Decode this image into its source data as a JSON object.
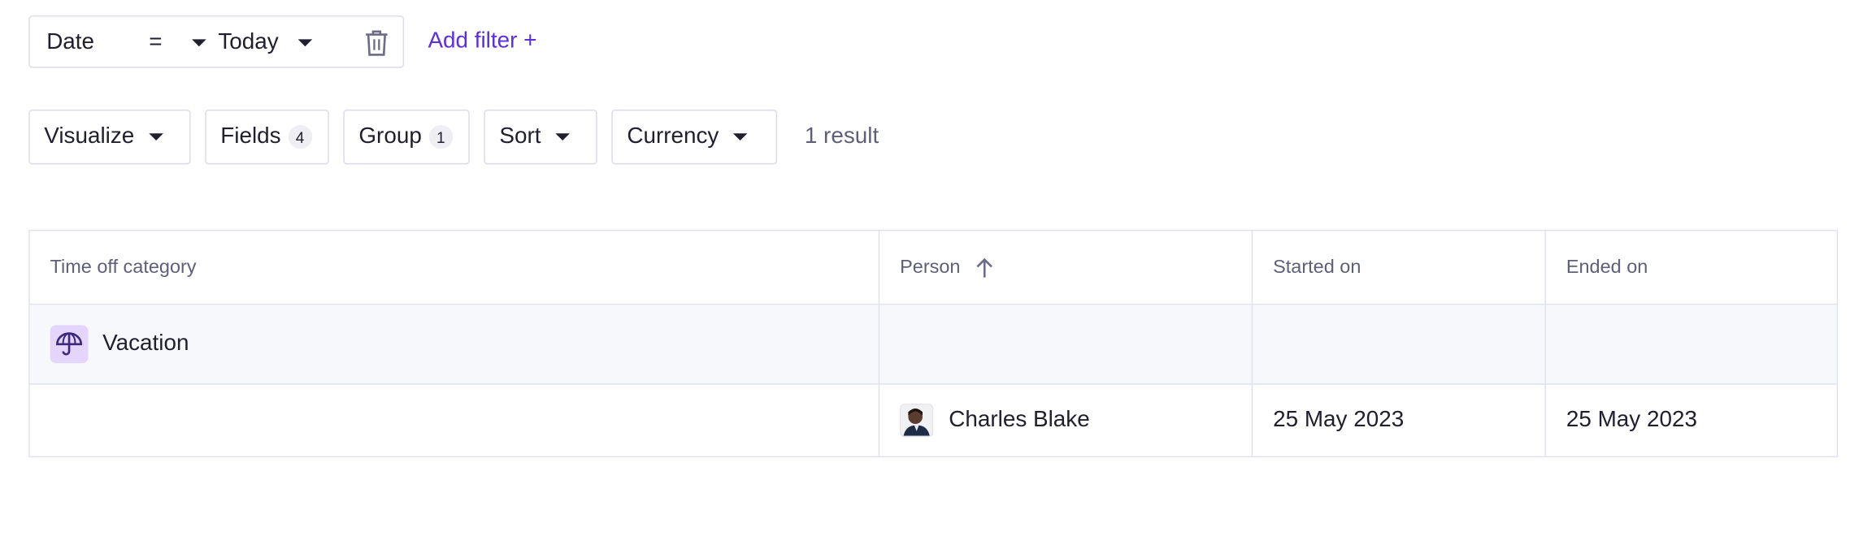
{
  "filter": {
    "field": "Date",
    "operator": "=",
    "value": "Today",
    "add_label": "Add filter +"
  },
  "toolbar": {
    "visualize": "Visualize",
    "fields": "Fields",
    "fields_count": "4",
    "group": "Group",
    "group_count": "1",
    "sort": "Sort",
    "currency": "Currency",
    "result_count": "1 result"
  },
  "table": {
    "columns": [
      "Time off category",
      "Person",
      "Started on",
      "Ended on"
    ],
    "group": {
      "label": "Vacation",
      "icon": "umbrella-icon"
    },
    "rows": [
      {
        "person": "Charles Blake",
        "started": "25 May 2023",
        "ended": "25 May 2023"
      }
    ]
  },
  "colors": {
    "accent": "#5b2ee0",
    "border": "#dfe1ed",
    "group_bg": "#f7f8fc",
    "icon_bg": "#e3d5fb"
  }
}
